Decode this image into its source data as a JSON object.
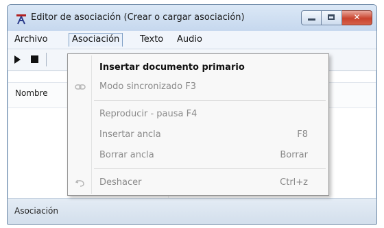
{
  "window": {
    "title": "Editor de asociación (Crear o cargar asociación)",
    "icon": "app-logo-icon"
  },
  "caption": {
    "close_glyph": "✕"
  },
  "menubar": {
    "items": [
      "Archivo",
      "Asociación",
      "Texto",
      "Audio"
    ],
    "active": "Asociación"
  },
  "toolbar": {
    "icons": [
      "play-icon",
      "stop-icon"
    ]
  },
  "list": {
    "column_header": "Nombre"
  },
  "status": {
    "text": "Asociación"
  },
  "dropdown": {
    "items": [
      {
        "label": "Insertar documento primario",
        "enabled": true,
        "shortcut": "",
        "icon": ""
      },
      {
        "label": "Modo sincronizado F3",
        "enabled": false,
        "shortcut": "",
        "icon": "link-icon"
      },
      {
        "label": "Reproducir - pausa F4",
        "enabled": false,
        "shortcut": "",
        "icon": ""
      },
      {
        "label": "Insertar ancla",
        "enabled": false,
        "shortcut": "F8",
        "icon": ""
      },
      {
        "label": "Borrar ancla",
        "enabled": false,
        "shortcut": "Borrar",
        "icon": ""
      },
      {
        "label": "Deshacer",
        "enabled": false,
        "shortcut": "Ctrl+z",
        "icon": "undo-icon"
      }
    ]
  },
  "colors": {
    "titlebar": "#c6d8ee",
    "close_button": "#c9432e",
    "menu_bg": "#f8f8f8"
  }
}
